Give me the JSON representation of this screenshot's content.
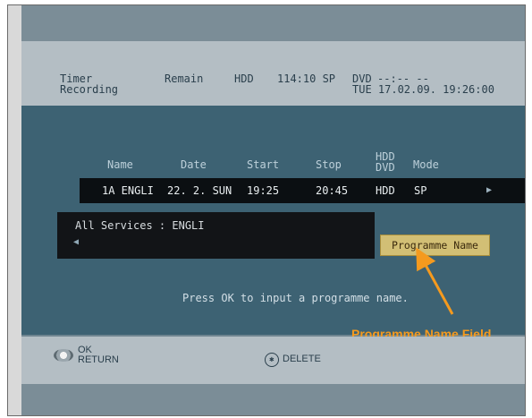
{
  "header": {
    "timer_recording": "Timer\nRecording",
    "remain_label": "Remain",
    "hdd_label": "HDD",
    "hdd_remain": "114:10 SP",
    "dvd_label": "DVD",
    "dvd_remain": "--:-- --",
    "datetime": "TUE 17.02.09. 19:26:00"
  },
  "table": {
    "columns": [
      "Name",
      "Date",
      "Start",
      "Stop",
      "HDD\nDVD",
      "Mode"
    ],
    "row": {
      "name": "1A ENGLI",
      "date": "22. 2. SUN",
      "start": "19:25",
      "stop": "20:45",
      "drive": "HDD",
      "mode": "SP"
    }
  },
  "info_box": {
    "service": "All Services : ENGLI"
  },
  "programme_button": "Programme Name",
  "hint": "Press OK to input a programme name.",
  "callout": "Programme Name Field",
  "footer": {
    "ok_label": "OK",
    "return_label": "RETURN",
    "delete_label": "DELETE"
  },
  "colors": {
    "accent": "#f59a1e",
    "button": "#d2bf75"
  }
}
